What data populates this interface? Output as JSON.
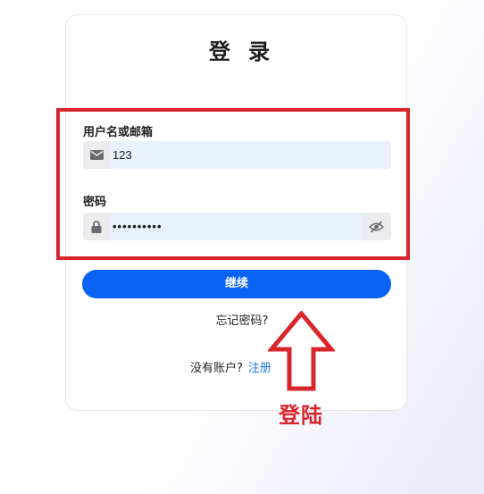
{
  "login": {
    "title": "登 录",
    "username_label": "用户名或邮箱",
    "username_value": "123",
    "password_label": "密码",
    "password_masked": "••••••••••",
    "continue_label": "继续",
    "forgot_label": "忘记密码?",
    "no_account_text": "没有账户?",
    "signup_link": "注册"
  },
  "annotation": {
    "text": "登陆",
    "color": "#d9262c"
  },
  "colors": {
    "primary_button": "#0a63f5",
    "input_bg": "#e9f0fe",
    "link": "#1a73e8"
  },
  "icons": {
    "username_icon": "envelope-icon",
    "password_icon": "lock-icon",
    "toggle_icon": "eye-slash-icon"
  }
}
